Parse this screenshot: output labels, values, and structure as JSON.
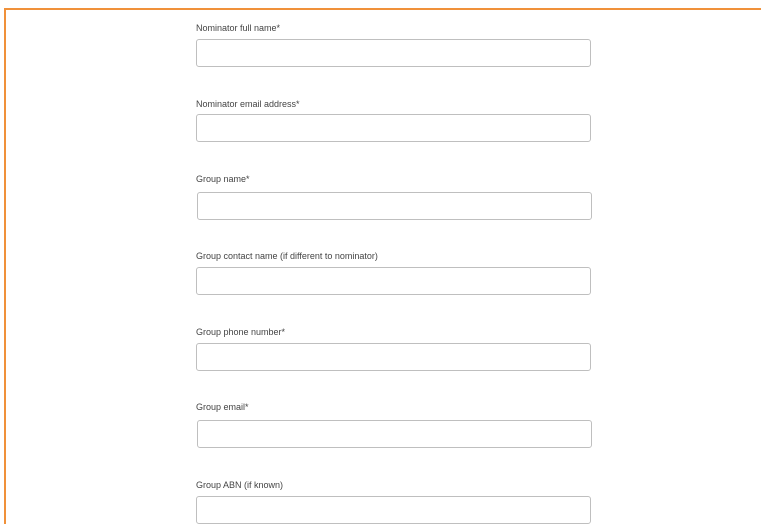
{
  "form": {
    "fields": [
      {
        "label": "Nominator full name*",
        "value": ""
      },
      {
        "label": "Nominator email address*",
        "value": ""
      },
      {
        "label": "Group name*",
        "value": ""
      },
      {
        "label": "Group contact name (if different to nominator)",
        "value": ""
      },
      {
        "label": "Group phone number*",
        "value": ""
      },
      {
        "label": "Group email*",
        "value": ""
      },
      {
        "label": "Group ABN (if known)",
        "value": ""
      }
    ]
  },
  "colors": {
    "frame_border": "#f0913a",
    "input_border": "#bfbfbf",
    "label_text": "#444444"
  }
}
